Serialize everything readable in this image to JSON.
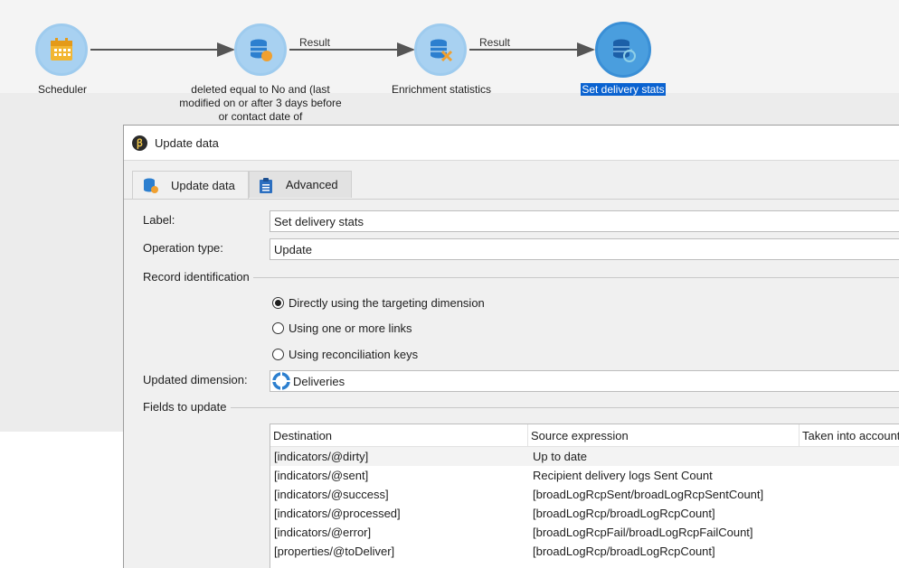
{
  "workflow": {
    "nodes": [
      {
        "label": "Scheduler",
        "icon": "calendar-icon"
      },
      {
        "label": "deleted equal to No and (last modified on or after 3 days before or contact date of",
        "icon": "database-query-icon"
      },
      {
        "label": "Enrichment statistics",
        "icon": "database-enrichment-icon"
      },
      {
        "label": "Set delivery stats",
        "icon": "database-update-icon"
      }
    ],
    "transitions": [
      "Result",
      "Result"
    ]
  },
  "dialog": {
    "title": "Update data",
    "tabs": [
      {
        "label": "Update data",
        "icon": "database-update-icon"
      },
      {
        "label": "Advanced",
        "icon": "clipboard-icon"
      }
    ],
    "label_caption": "Label:",
    "label_value": "Set delivery stats",
    "operation_caption": "Operation type:",
    "operation_value": "Update",
    "record_section": "Record identification",
    "radio_options": [
      {
        "label": "Directly using the targeting dimension",
        "checked": true
      },
      {
        "label": "Using one or more links",
        "checked": false
      },
      {
        "label": "Using reconciliation keys",
        "checked": false
      }
    ],
    "dimension_caption": "Updated dimension:",
    "dimension_value": "Deliveries",
    "fields_section": "Fields to update",
    "table": {
      "columns": [
        "Destination",
        "Source expression",
        "Taken into account if"
      ],
      "rows": [
        [
          "[indicators/@dirty]",
          "Up to date"
        ],
        [
          "[indicators/@sent]",
          "Recipient delivery logs Sent Count"
        ],
        [
          "[indicators/@success]",
          "[broadLogRcpSent/broadLogRcpSentCount]"
        ],
        [
          "[indicators/@processed]",
          "[broadLogRcp/broadLogRcpCount]"
        ],
        [
          "[indicators/@error]",
          "[broadLogRcpFail/broadLogRcpFailCount]"
        ],
        [
          "[properties/@toDeliver]",
          "[broadLogRcp/broadLogRcpCount]"
        ]
      ]
    }
  },
  "colors": {
    "accent": "#0a62d0",
    "node": "#a8d1f1",
    "node_active": "#4a9ede",
    "icon_orange": "#f0a030"
  }
}
